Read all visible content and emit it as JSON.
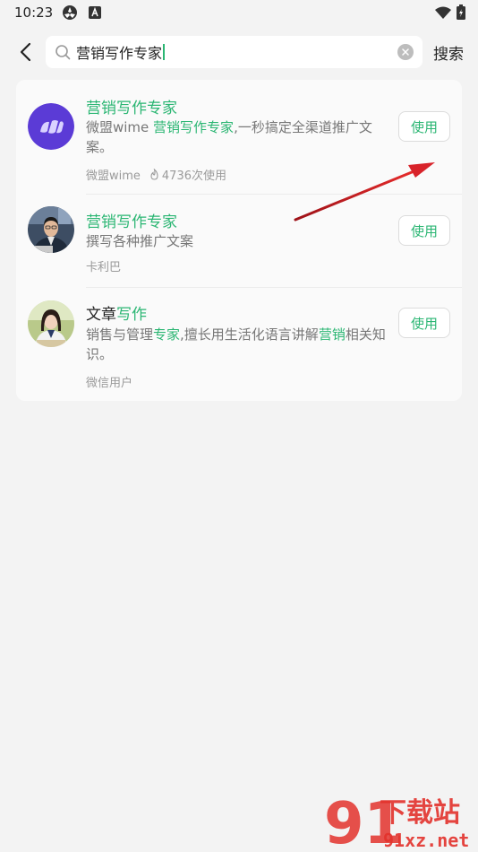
{
  "status_bar": {
    "time": "10:23",
    "icons": [
      "app-notification-icon",
      "keyboard-a-icon",
      "wifi-icon",
      "battery-icon"
    ]
  },
  "search": {
    "query": "营销写作专家",
    "submit_label": "搜索"
  },
  "results": [
    {
      "title_parts": [
        {
          "text": "营销写作专家",
          "hl": true
        }
      ],
      "desc_parts": [
        {
          "text": "微盟wime ",
          "hl": false
        },
        {
          "text": "营销写作专家",
          "hl": true
        },
        {
          "text": ",一秒搞定全渠道推广文案。",
          "hl": false
        }
      ],
      "author": "微盟wime",
      "usage": "4736次使用",
      "button": "使用"
    },
    {
      "title_parts": [
        {
          "text": "营销写作专家",
          "hl": true
        }
      ],
      "desc_parts": [
        {
          "text": "撰写各种推广文案",
          "hl": false
        }
      ],
      "author": "卡利巴",
      "button": "使用"
    },
    {
      "title_parts": [
        {
          "text": "文章",
          "hl": false
        },
        {
          "text": "写作",
          "hl": true
        }
      ],
      "desc_parts": [
        {
          "text": "销售与管理",
          "hl": false
        },
        {
          "text": "专家",
          "hl": true
        },
        {
          "text": ",擅长用生活化语言讲解",
          "hl": false
        },
        {
          "text": "营销",
          "hl": true
        },
        {
          "text": "相关知识。",
          "hl": false
        }
      ],
      "author": "微信用户",
      "button": "使用"
    }
  ],
  "watermark": {
    "brand": "下载站",
    "domain": "91xz.net",
    "logo_digits": "91"
  },
  "colors": {
    "accent": "#2bb673",
    "annotation_arrow": "#d8232a",
    "background": "#f3f3f3"
  }
}
